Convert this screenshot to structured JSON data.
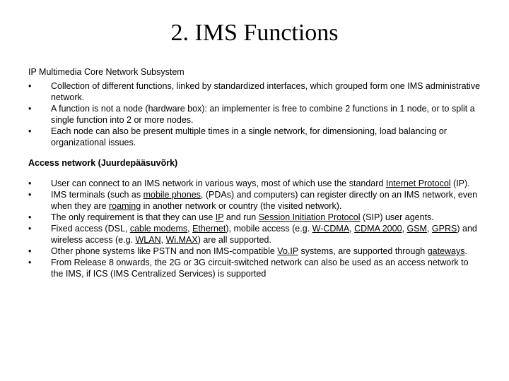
{
  "title": "2. IMS Functions",
  "intro": "IP Multimedia Core Network Subsystem",
  "list1_plain": [
    "Collection of different functions, linked by standardized interfaces, which grouped form one IMS administrative network.",
    "A function is not a node (hardware box): an implementer is free to combine 2 functions in 1 node, or to split a single function into 2 or more nodes.",
    "Each node can also be present multiple times in a single network, for dimensioning, load balancing or organizational issues."
  ],
  "subhead": "Access network (Juurdepääsuvõrk)",
  "list2_plain": [
    "User can connect to an IMS network in various ways, most of which use the standard Internet Protocol (IP).",
    "IMS terminals (such as mobile phones, (PDAs) and computers) can register directly on an IMS network, even when they are roaming in another network or country (the visited network).",
    "The only requirement is that they can use IP and run Session Initiation Protocol (SIP) user agents.",
    "Fixed access (DSL, cable modems, Ethernet), mobile access (e.g. W-CDMA, CDMA 2000, GSM, GPRS) and wireless access (e.g. WLAN, Wi.MAX) are all supported.",
    "Other phone systems like PSTN and non IMS-compatible Vo.IP systems, are supported through gateways.",
    "From Release 8 onwards, the 2G or 3G circuit-switched network can also be used as an access network to the IMS, if ICS (IMS Centralized Services) is supported"
  ],
  "list1_html": [
    "Collection of different functions, linked by standardized interfaces, which grouped form one IMS administrative network.",
    "A function is not a node (hardware box): an implementer is free to combine 2 functions in 1 node, or to split a single function into 2 or more nodes.",
    "Each node can also be present multiple times in a single network, for dimensioning, load balancing or organizational issues."
  ],
  "list2_html": [
    "User can connect to an IMS network in various ways, most of which use the standard <span class=\"u\">Internet Protocol</span> (IP).",
    "IMS terminals (such as <span class=\"u\">mobile phones</span>, (PDAs) and computers) can register directly on an IMS network, even when they are <span class=\"u\">roaming</span> in another network or country (the visited network).",
    "The only requirement is that they can use <span class=\"u\">IP</span> and run <span class=\"u\">Session Initiation Protocol</span> (SIP) user agents.",
    "Fixed access (DSL, <span class=\"u\">cable modems</span>, <span class=\"u\">Ethernet</span>), mobile access (e.g. <span class=\"u\">W-CDMA</span>, <span class=\"u\">CDMA 2000</span>, <span class=\"u\">GSM</span>, <span class=\"u\">GPRS</span>) and wireless access (e.g. <span class=\"u\">WLAN</span>, <span class=\"u\">Wi.MAX</span>) are all supported.",
    "Other phone systems like PSTN and non IMS-compatible <span class=\"u\">Vo.IP</span> systems, are supported through <span class=\"u\">gateways</span>.",
    "From Release 8 onwards, the 2G or 3G circuit-switched network can also be used as an access network to the IMS, if ICS (IMS Centralized Services) is supported"
  ]
}
